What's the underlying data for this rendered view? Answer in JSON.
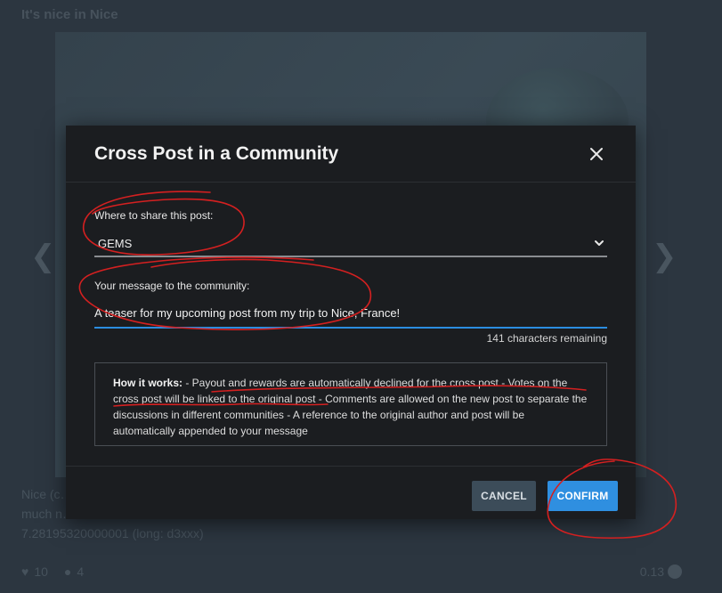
{
  "background": {
    "post_title": "It's nice in Nice",
    "body_lines": [
      "Nice (c…                                                                                                                              with",
      "much n…                                                                                                                                 t",
      "7.28195320000001 (long: d3xxx)"
    ],
    "footer": {
      "votes": "10",
      "comments": "4",
      "payout": "0.13"
    }
  },
  "modal": {
    "title": "Cross Post in a Community",
    "community_label": "Where to share this post:",
    "community_value": "GEMS",
    "message_label": "Your message to the community:",
    "message_value": "A teaser for my upcoming post from my trip to Nice, France!",
    "chars_remaining": "141 characters remaining",
    "how_it_works_label": "How it works:",
    "how_it_works_text": " - Payout and rewards are automatically declined for the cross post - Votes on the cross post will be linked to the original post - Comments are allowed on the new post to separate the discussions in different communities - A reference to the original author and post will be automatically appended to your message",
    "cancel_label": "CANCEL",
    "confirm_label": "CONFIRM"
  },
  "colors": {
    "accent": "#2f8fe0",
    "modal_bg": "#1b1d20",
    "annotation": "#d42020"
  },
  "icons": [
    "close-icon",
    "chevron-down-icon",
    "heart-icon",
    "comment-icon",
    "chevron-left-icon",
    "chevron-right-icon"
  ]
}
